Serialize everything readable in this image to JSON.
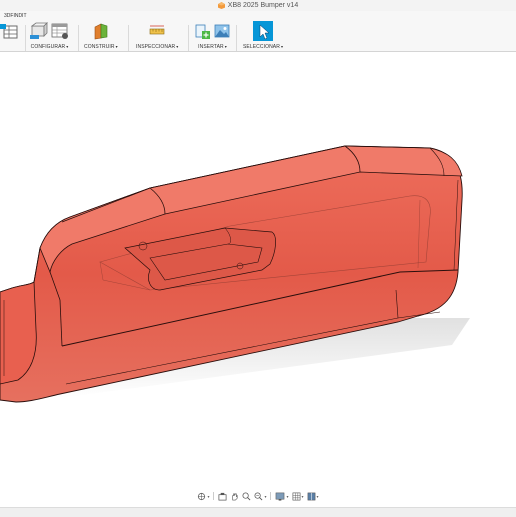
{
  "window": {
    "title": "XB8 2025 Bumper v14"
  },
  "toolbar": {
    "workspace": "3DFINDIT",
    "groups": [
      {
        "name": "configurar",
        "label": "CONFIGURAR"
      },
      {
        "name": "construir",
        "label": "CONSTRUIR"
      },
      {
        "name": "inspeccionar",
        "label": "INSPECCIONAR"
      },
      {
        "name": "insertar",
        "label": "INSERTAR"
      },
      {
        "name": "seleccionar",
        "label": "SELECCIONAR"
      }
    ],
    "dropdown_caret": "▾"
  },
  "colors": {
    "part_fill": "#e25a4a",
    "part_edge": "#2a0e0c",
    "accent": "#0696d7",
    "toolbar_bg": "#f7f7f7"
  },
  "nav_bar": {
    "icons": [
      "orbit-icon",
      "pan-icon",
      "look-at-icon",
      "hand-icon",
      "zoom-icon",
      "zoom-window-icon",
      "display-settings-icon",
      "grid-icon",
      "viewports-icon"
    ]
  }
}
